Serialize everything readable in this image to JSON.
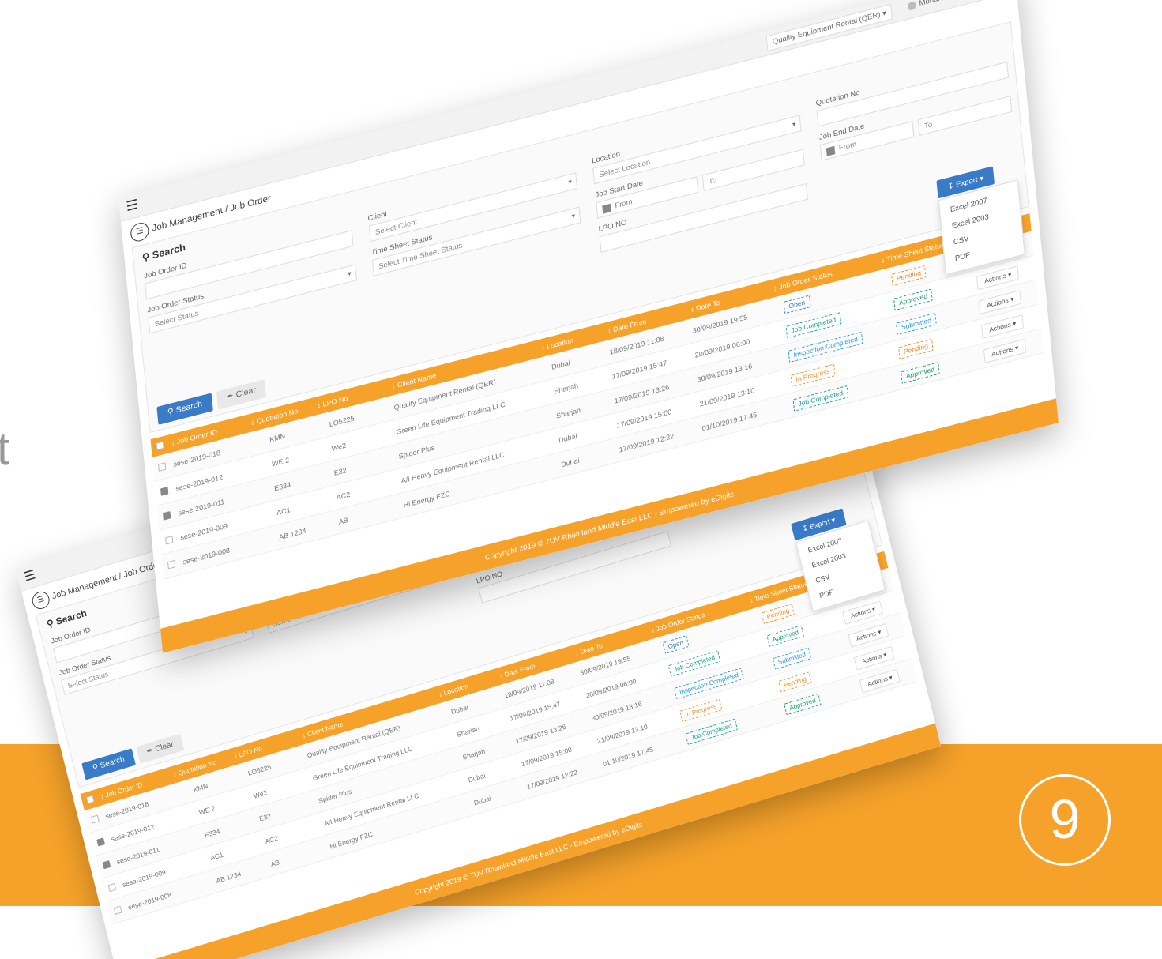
{
  "page_number": "9",
  "edge_glyph": "t",
  "app": {
    "company": "Quality Equipment Rental (QER)",
    "user_name": "Mohamed Atta",
    "breadcrumb": "Job Management / Job Order"
  },
  "search": {
    "title": "Search",
    "fields": {
      "job_order_id": "Job Order ID",
      "job_order_status": "Job Order Status",
      "job_order_status_placeholder": "Select Status",
      "client": "Client",
      "client_placeholder": "Select Client",
      "time_sheet_status": "Time Sheet Status",
      "time_sheet_status_placeholder": "Select Time Sheet Status",
      "location": "Location",
      "location_placeholder": "Select Location",
      "job_start_date": "Job Start Date",
      "lpo_no": "LPO NO",
      "quotation_no": "Quotation No",
      "job_end_date": "Job End Date",
      "from": "From",
      "to": "To"
    },
    "search_button": "Search",
    "clear_button": "Clear"
  },
  "export": {
    "button": "Export",
    "options": [
      "Excel 2007",
      "Excel 2003",
      "CSV",
      "PDF"
    ]
  },
  "table": {
    "columns": [
      "Job Order ID",
      "Quotation No",
      "LPO No",
      "Client Name",
      "Location",
      "Date From",
      "Date To",
      "Job Order Status",
      "Time Sheet Status",
      ""
    ],
    "rows": [
      {
        "checked": false,
        "id": "sese-2019-018",
        "quotation": "KMN",
        "lpo": "LO5225",
        "client": "Quality Equipment Rental (QER)",
        "location": "Dubai",
        "from": "18/09/2019 11:08",
        "to": "30/09/2019 19:55",
        "job_status": "Open",
        "job_status_class": "b-open",
        "ts_status": "Pending",
        "ts_status_class": "b-pend",
        "action": "Actions"
      },
      {
        "checked": true,
        "id": "sese-2019-012",
        "quotation": "WE 2",
        "lpo": "We2",
        "client": "Green Life Equipment Trading LLC",
        "location": "Sharjah",
        "from": "17/09/2019 15:47",
        "to": "20/09/2019 06:00",
        "job_status": "Job Completed",
        "job_status_class": "b-done",
        "ts_status": "Approved",
        "ts_status_class": "b-appr",
        "action": "Actions"
      },
      {
        "checked": true,
        "id": "sese-2019-011",
        "quotation": "E334",
        "lpo": "E32",
        "client": "Spider Plus",
        "location": "Sharjah",
        "from": "17/09/2019 13:26",
        "to": "30/09/2019 13:16",
        "job_status": "Inspection Completed",
        "job_status_class": "b-insp",
        "ts_status": "Submitted",
        "ts_status_class": "b-subm",
        "action": "Actions"
      },
      {
        "checked": false,
        "id": "sese-2019-009",
        "quotation": "AC1",
        "lpo": "AC2",
        "client": "A/I Heavy Equipment Rental LLC",
        "location": "Dubai",
        "from": "17/09/2019 15:00",
        "to": "21/09/2019 13:10",
        "job_status": "In Progress",
        "job_status_class": "b-prog",
        "ts_status": "Pending",
        "ts_status_class": "b-pend",
        "action": "Actions"
      },
      {
        "checked": false,
        "id": "sese-2019-008",
        "quotation": "AB 1234",
        "lpo": "AB",
        "client": "Hi Energy FZC",
        "location": "Dubai",
        "from": "17/09/2019 12:22",
        "to": "01/10/2019 17:45",
        "job_status": "Job Completed",
        "job_status_class": "b-done",
        "ts_status": "Approved",
        "ts_status_class": "b-appr",
        "action": "Actions"
      }
    ]
  },
  "footer": "Copyright 2019 © TUV Rheinland Middle East LLC - Empowered by eDigits",
  "colors": {
    "accent": "#f6a22a",
    "primary": "#3a7bc8"
  }
}
